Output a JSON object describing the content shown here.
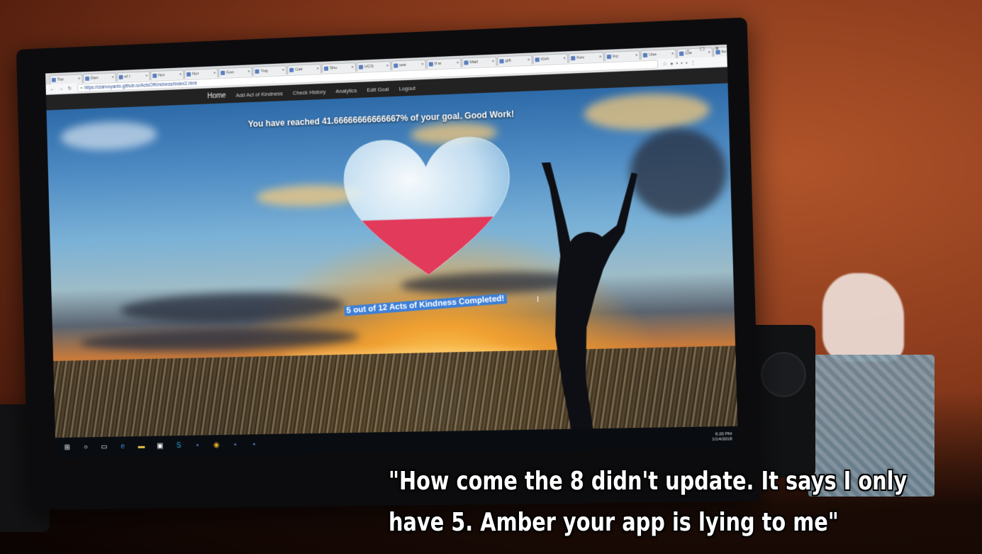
{
  "browser": {
    "tabs": [
      "Top",
      "Dan",
      "ef /",
      "Nor",
      "Nor",
      "Goc",
      "Yog",
      "Calr",
      "Sho",
      "UCS",
      "tew",
      "If w",
      "Mail",
      "gift",
      "iGrh",
      "Kev",
      "loy",
      "Use",
      "Cle",
      "ko"
    ],
    "url": "https://clairvoyantx.github.io/ActsOfKindness/index2.html",
    "window_controls": "– ☐ ✕"
  },
  "site": {
    "nav": [
      "Home",
      "Add Act of Kindness",
      "Check History",
      "Analytics",
      "Edit Goal",
      "Logout"
    ],
    "goal_text": "You have reached 41.66666666666667% of your goal. Good Work!",
    "completed_text": "5 out of 12 Acts of Kindness Completed!",
    "progress": {
      "completed": 5,
      "total": 12,
      "percent": 41.66666666666667
    },
    "heart_fill_color": "#e23a5a"
  },
  "taskbar": {
    "icons": [
      "windows-start-icon",
      "cortana-icon",
      "task-view-icon",
      "edge-icon",
      "file-explorer-icon",
      "store-icon",
      "skype-icon",
      "app-icon",
      "chrome-icon",
      "app-icon",
      "app-icon"
    ],
    "tray_time": "6:20 PM",
    "tray_date": "1/14/2018"
  },
  "caption": {
    "line1": "\"How come the 8 didn't update. It says I only",
    "line2": "have 5. Amber your app is lying to me\""
  }
}
